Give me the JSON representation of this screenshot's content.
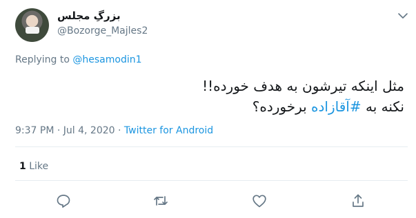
{
  "author": {
    "display_name": "بزرگِ مجلس",
    "handle": "@Bozorge_Majles2"
  },
  "reply": {
    "prefix": "Replying to",
    "mention": "@hesamodin1"
  },
  "tweet": {
    "line1": "مثل اینکه تیرشون به هدف خورده!!",
    "line2_prefix": "نکنه به",
    "hashtag": "#آقازاده",
    "line2_suffix": "برخورده؟"
  },
  "meta": {
    "time": "9:37 PM",
    "separator1": "·",
    "date": "Jul 4, 2020",
    "separator2": "·",
    "source": "Twitter for Android"
  },
  "stats": {
    "like_count": "1",
    "like_label": "Like"
  },
  "actions": [
    "reply-icon",
    "retweet-icon",
    "like-icon",
    "share-icon"
  ],
  "colors": {
    "link": "#1b95e0",
    "secondary": "#657786",
    "divider": "#e6ecf0",
    "text": "#14171a"
  }
}
